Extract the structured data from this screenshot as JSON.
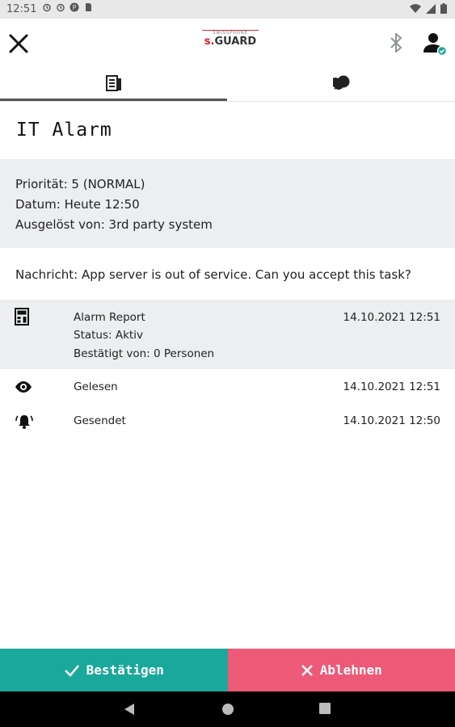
{
  "status_bar": {
    "time": "12:51"
  },
  "header": {
    "logo_top": "SWISSPHONE",
    "logo_prefix": "s.",
    "logo_main": "GUARD"
  },
  "tabs": [
    {
      "icon": "details-icon",
      "active": true
    },
    {
      "icon": "chat-icon",
      "active": false
    }
  ],
  "alarm": {
    "title": "IT Alarm",
    "priority": "Priorität: 5 (NORMAL)",
    "date": "Datum: Heute 12:50",
    "triggered_by": "Ausgelöst von: 3rd party system",
    "message": "Nachricht: App server is out of service. Can you accept this task?"
  },
  "history": [
    {
      "icon": "report-icon",
      "lines": [
        "Alarm Report",
        "Status: Aktiv",
        "Bestätigt von: 0 Personen"
      ],
      "time": "14.10.2021 12:51"
    },
    {
      "icon": "eye-icon",
      "lines": [
        "Gelesen"
      ],
      "time": "14.10.2021 12:51"
    },
    {
      "icon": "bell-icon",
      "lines": [
        "Gesendet"
      ],
      "time": "14.10.2021 12:50"
    }
  ],
  "actions": {
    "confirm_label": "Bestätigen",
    "reject_label": "Ablehnen"
  },
  "colors": {
    "confirm": "#1aa89a",
    "reject": "#ec5a78",
    "info_bg": "#eceef0",
    "logo_red": "#d3202a",
    "verified_badge": "#1aa89a"
  }
}
